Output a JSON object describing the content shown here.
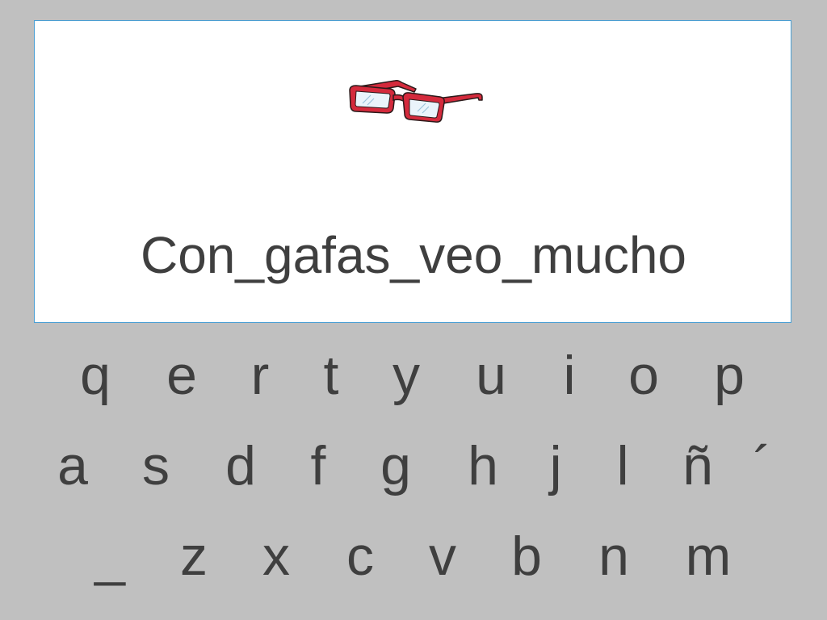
{
  "card": {
    "image_icon": "red-glasses-icon",
    "sentence": "Con_gafas_veo_mucho"
  },
  "keyboard": {
    "row1": [
      "q",
      "e",
      "r",
      "t",
      "y",
      "u",
      "i",
      "o",
      "p"
    ],
    "row2": [
      "a",
      "s",
      "d",
      "f",
      "g",
      "h",
      "j",
      "l",
      "ñ",
      "´"
    ],
    "row3": [
      "_",
      "z",
      "x",
      "c",
      "v",
      "b",
      "n",
      "m"
    ]
  },
  "colors": {
    "background": "#c0c0c0",
    "card": "#ffffff",
    "card_border": "#4a9fd4",
    "text": "#3f3f3f",
    "glasses_frame": "#d42a3c"
  }
}
